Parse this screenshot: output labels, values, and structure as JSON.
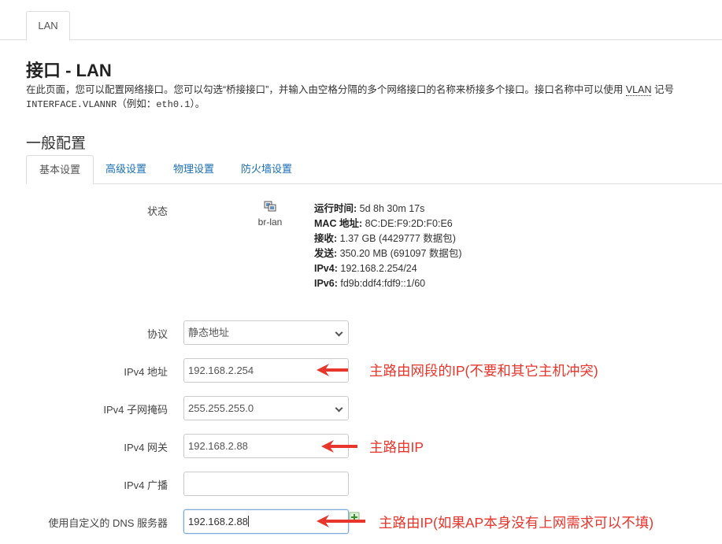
{
  "top_tab": "LAN",
  "page": {
    "title": "接口 - LAN",
    "desc_part1": "在此页面，您可以配置网络接口。您可以勾选“桥接接口”，并输入由空格分隔的多个网络接口的名称来桥接多个接口。接口名称中可以使用 ",
    "desc_abbr": "VLAN",
    "desc_part2": " 记号",
    "desc_code": "INTERFACE.VLANNR",
    "desc_part3": "（例如：",
    "desc_example": "eth0.1",
    "desc_part4": "）。"
  },
  "section_title": "一般配置",
  "sub_tabs": [
    "基本设置",
    "高级设置",
    "物理设置",
    "防火墙设置"
  ],
  "status": {
    "label": "状态",
    "interface": "br-lan",
    "interface_icon": "ethernet-port-icon",
    "uptime_label": "运行时间:",
    "uptime": "5d 8h 30m 17s",
    "mac_label": "MAC 地址:",
    "mac": "8C:DE:F9:2D:F0:E6",
    "rx_label": "接收:",
    "rx": "1.37 GB (4429777 数据包)",
    "tx_label": "发送:",
    "tx": "350.20 MB (691097 数据包)",
    "ipv4_label": "IPv4:",
    "ipv4": "192.168.2.254/24",
    "ipv6_label": "IPv6:",
    "ipv6": "fd9b:ddf4:fdf9::1/60"
  },
  "form": {
    "protocol": {
      "label": "协议",
      "value": "静态地址"
    },
    "ipv4_addr": {
      "label": "IPv4 地址",
      "value": "192.168.2.254"
    },
    "netmask": {
      "label": "IPv4 子网掩码",
      "value": "255.255.255.0"
    },
    "gateway": {
      "label": "IPv4 网关",
      "value": "192.168.2.88"
    },
    "broadcast": {
      "label": "IPv4 广播",
      "value": ""
    },
    "dns": {
      "label": "使用自定义的 DNS 服务器",
      "value": "192.168.2.88"
    }
  },
  "annotations": {
    "ipv4_note": "主路由网段的IP(不要和其它主机冲突)",
    "gateway_note": "主路由IP",
    "dns_note": "主路由IP(如果AP本身没有上网需求可以不填)",
    "color": "#e8362d"
  },
  "colors": {
    "link": "#1a6fb5",
    "border": "#dddddd"
  }
}
